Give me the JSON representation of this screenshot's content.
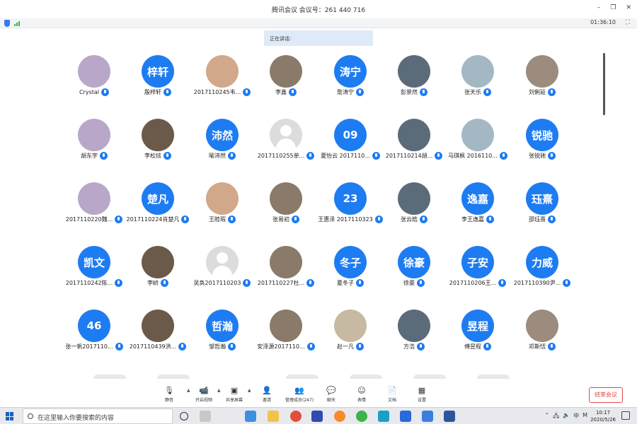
{
  "window": {
    "title": "腾讯会议 会议号：261 440 716",
    "timer": "01:36:10"
  },
  "speaking_label": "正在讲话:",
  "participants": [
    {
      "name": "Crystal",
      "avatar": "photo",
      "initials": ""
    },
    {
      "name": "殷梓轩",
      "avatar": "blue",
      "initials": "梓轩"
    },
    {
      "name": "2017110245韦...",
      "avatar": "photo",
      "initials": ""
    },
    {
      "name": "李鑫",
      "avatar": "photo",
      "initials": ""
    },
    {
      "name": "詹涛宁",
      "avatar": "blue",
      "initials": "涛宁"
    },
    {
      "name": "彭景然",
      "avatar": "photo",
      "initials": ""
    },
    {
      "name": "张天乐",
      "avatar": "photo",
      "initials": ""
    },
    {
      "name": "刘俐延",
      "avatar": "photo",
      "initials": ""
    },
    {
      "name": "胡东宇",
      "avatar": "photo",
      "initials": ""
    },
    {
      "name": "李松炫",
      "avatar": "photo",
      "initials": ""
    },
    {
      "name": "喻沛然",
      "avatar": "blue",
      "initials": "沛然"
    },
    {
      "name": "2017110255单...",
      "avatar": "gray",
      "initials": ""
    },
    {
      "name": "夏怡云 2017110...",
      "avatar": "blue",
      "initials": "09"
    },
    {
      "name": "2017110214胡...",
      "avatar": "photo",
      "initials": ""
    },
    {
      "name": "马琪枫 2016110...",
      "avatar": "photo",
      "initials": ""
    },
    {
      "name": "张锐驰",
      "avatar": "blue",
      "initials": "锐驰"
    },
    {
      "name": "2017110220魏...",
      "avatar": "photo",
      "initials": ""
    },
    {
      "name": "2017110224肖楚凡",
      "avatar": "blue",
      "initials": "楚凡"
    },
    {
      "name": "王睦瑕",
      "avatar": "photo",
      "initials": ""
    },
    {
      "name": "张易初",
      "avatar": "photo",
      "initials": ""
    },
    {
      "name": "王惠泽 2017110323",
      "avatar": "blue",
      "initials": "23"
    },
    {
      "name": "张云皓",
      "avatar": "photo",
      "initials": ""
    },
    {
      "name": "李王逸嘉",
      "avatar": "blue",
      "initials": "逸嘉"
    },
    {
      "name": "邵珏熹",
      "avatar": "blue",
      "initials": "珏熹"
    },
    {
      "name": "2017110242陈...",
      "avatar": "blue",
      "initials": "凯文"
    },
    {
      "name": "李峤",
      "avatar": "photo",
      "initials": ""
    },
    {
      "name": "吴奂2017110203",
      "avatar": "gray",
      "initials": ""
    },
    {
      "name": "2017110227杜...",
      "avatar": "photo",
      "initials": ""
    },
    {
      "name": "夏冬子",
      "avatar": "blue",
      "initials": "冬子"
    },
    {
      "name": "徐豪",
      "avatar": "blue",
      "initials": "徐豪"
    },
    {
      "name": "2017110206王...",
      "avatar": "blue",
      "initials": "子安"
    },
    {
      "name": "2017110390尹...",
      "avatar": "blue",
      "initials": "力威"
    },
    {
      "name": "张一帆2017110...",
      "avatar": "blue",
      "initials": "46"
    },
    {
      "name": "2017110439洪...",
      "avatar": "photo",
      "initials": ""
    },
    {
      "name": "邹哲瀚",
      "avatar": "blue",
      "initials": "哲瀚"
    },
    {
      "name": "安泽源2017110...",
      "avatar": "photo",
      "initials": ""
    },
    {
      "name": "赵一凡",
      "avatar": "photo",
      "initials": ""
    },
    {
      "name": "方浩",
      "avatar": "photo",
      "initials": ""
    },
    {
      "name": "傅昱程",
      "avatar": "blue",
      "initials": "昱程"
    },
    {
      "name": "邓斯恬",
      "avatar": "photo",
      "initials": ""
    }
  ],
  "toolbar": {
    "items": [
      {
        "label": "静音",
        "icon": "microphone-icon"
      },
      {
        "label": "开启视频",
        "icon": "camera-off-icon"
      },
      {
        "label": "共享屏幕",
        "icon": "share-screen-icon"
      },
      {
        "label": "邀请",
        "icon": "invite-icon"
      },
      {
        "label": "管理成员(247)",
        "icon": "members-icon"
      },
      {
        "label": "聊天",
        "icon": "chat-icon"
      },
      {
        "label": "表情",
        "icon": "emoji-icon"
      },
      {
        "label": "文档",
        "icon": "document-icon"
      },
      {
        "label": "设置",
        "icon": "settings-icon"
      }
    ],
    "end_label": "结束会议"
  },
  "taskbar": {
    "search_placeholder": "在这里输入你要搜索的内容",
    "clock_time": "10:17",
    "clock_date": "2020/5/26",
    "ime": "中",
    "tray_letter": "M"
  },
  "colors": {
    "accent": "#1e7cf2",
    "end": "#e04848"
  }
}
